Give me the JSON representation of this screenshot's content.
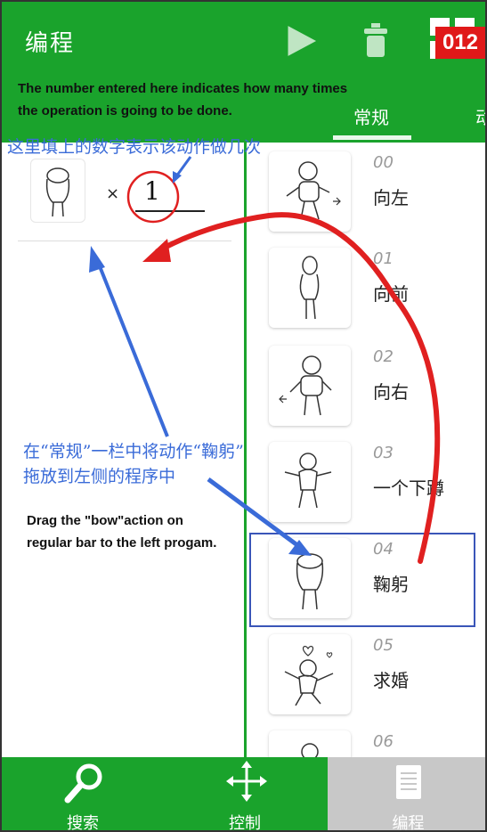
{
  "header": {
    "title": "编程",
    "counter_badge": "012"
  },
  "annotations": {
    "top_note_line1": "The number entered here indicates how many times",
    "top_note_line2": "the operation is going to be done.",
    "cn_note_count": "这里填上的数字表示该动作做几次",
    "cn_note_drag_line1": "在“常规”一栏中将动作“鞠躬”",
    "cn_note_drag_line2": "拖放到左侧的程序中",
    "en_drag_line1": "Drag the \"bow\"action on",
    "en_drag_line2": "regular bar to the left progam."
  },
  "tabs": [
    {
      "label": "常规",
      "active": true
    },
    {
      "label": "动"
    }
  ],
  "program": {
    "times_symbol": "×",
    "count_value": "1"
  },
  "actions": [
    {
      "num": "00",
      "label": "向左"
    },
    {
      "num": "01",
      "label": "向前"
    },
    {
      "num": "02",
      "label": "向右"
    },
    {
      "num": "03",
      "label": "一个下蹲"
    },
    {
      "num": "04",
      "label": "鞠躬"
    },
    {
      "num": "05",
      "label": "求婚"
    },
    {
      "num": "06",
      "label": ""
    }
  ],
  "bottom_nav": [
    {
      "label": "搜索",
      "icon": "search-icon"
    },
    {
      "label": "控制",
      "icon": "move-icon"
    },
    {
      "label": "编程",
      "icon": "list-icon",
      "active": true
    }
  ],
  "colors": {
    "green": "#1aa32c",
    "annotation_blue": "#3a6bd8",
    "annotation_red": "#e02020",
    "badge_red": "#e01919"
  }
}
